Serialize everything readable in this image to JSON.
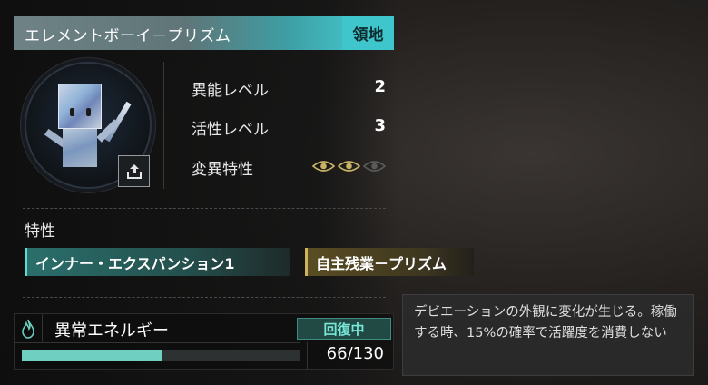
{
  "header": {
    "name": "エレメントボーイ－プリズム",
    "tag": "領地"
  },
  "stats": [
    {
      "label": "異能レベル",
      "value": "2"
    },
    {
      "label": "活性レベル",
      "value": "3"
    },
    {
      "label": "変異特性",
      "active": 2,
      "total": 3
    }
  ],
  "traits": {
    "title": "特性",
    "items": [
      {
        "label": "インナー・エクスパンション1"
      },
      {
        "label": "自主残業－プリズム"
      }
    ]
  },
  "energy": {
    "title": "異常エネルギー",
    "status": "回復中",
    "current": 66,
    "max": 130,
    "display": "66/130",
    "fill_fraction": 0.508
  },
  "tooltip": {
    "text": "デビエーションの外観に変化が生じる。稼働する時、15%の確率で活躍度を消費しない"
  },
  "icons": {
    "upload": "upload-icon",
    "flame": "flame-icon",
    "mutation": "eye-icon"
  },
  "colors": {
    "accent_teal": "#44d7de",
    "trait_gold": "#cdb35a",
    "mutation_active": "#c8b464",
    "mutation_inactive": "#5a5a5a",
    "energy_fill": "#6fd0c2"
  }
}
